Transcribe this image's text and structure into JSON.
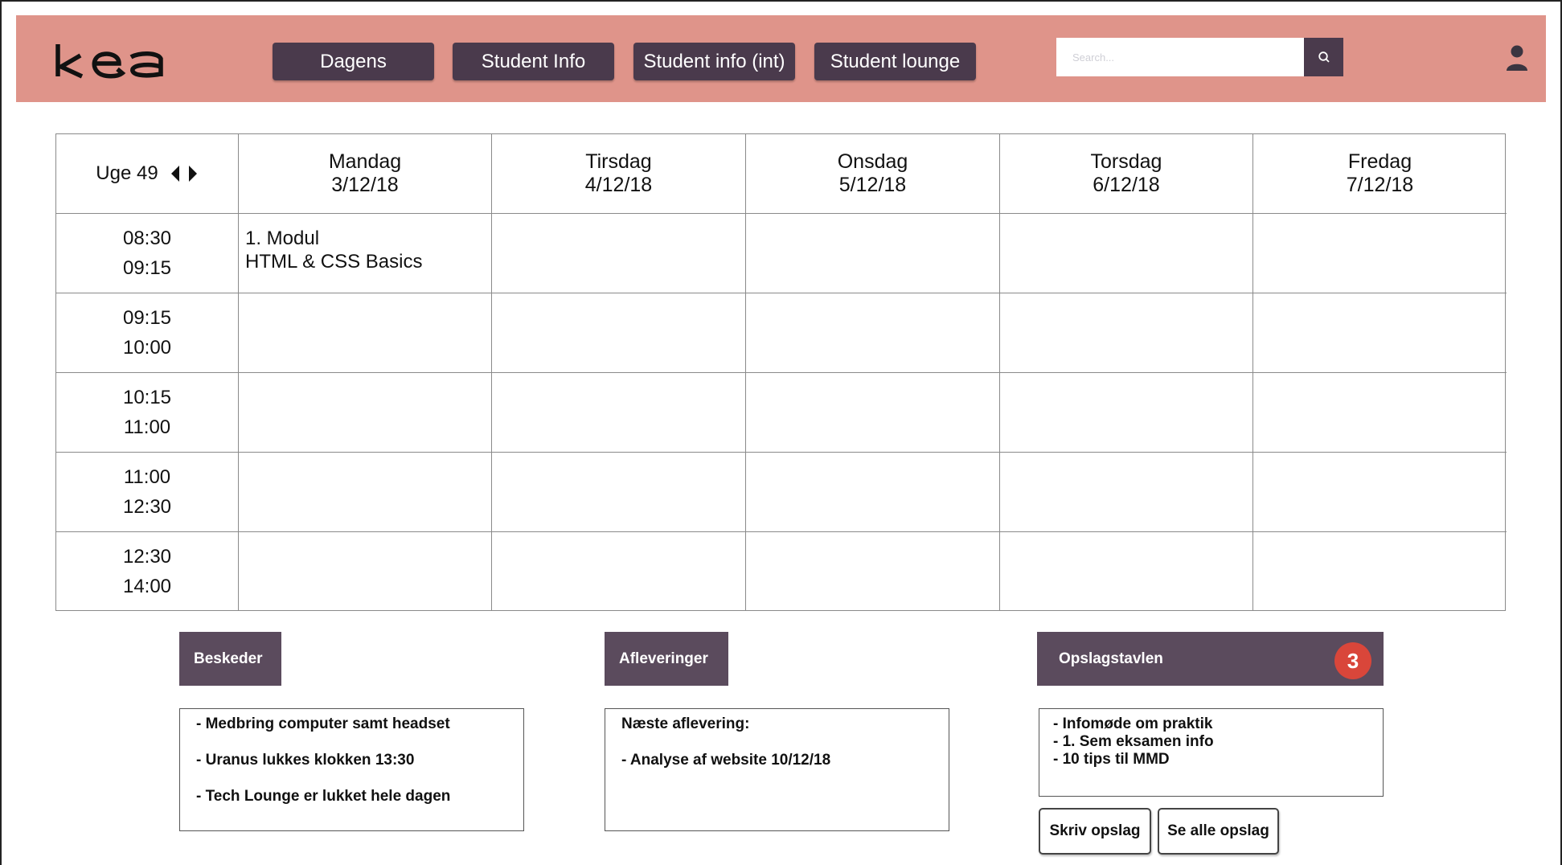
{
  "header": {
    "logo_text": "kea",
    "nav": [
      "Dagens",
      "Student Info",
      "Student info (int)",
      "Student lounge"
    ],
    "search_placeholder": "Search..."
  },
  "schedule": {
    "week_label": "Uge 49",
    "days": [
      {
        "name": "Mandag",
        "date": "3/12/18"
      },
      {
        "name": "Tirsdag",
        "date": "4/12/18"
      },
      {
        "name": "Onsdag",
        "date": "5/12/18"
      },
      {
        "name": "Torsdag",
        "date": "6/12/18"
      },
      {
        "name": "Fredag",
        "date": "7/12/18"
      }
    ],
    "times": [
      {
        "start": "08:30",
        "end": "09:15"
      },
      {
        "start": "09:15",
        "end": "10:00"
      },
      {
        "start": "10:15",
        "end": "11:00"
      },
      {
        "start": "11:00",
        "end": "12:30"
      },
      {
        "start": "12:30",
        "end": "14:00"
      }
    ],
    "event": {
      "line1": "1. Modul",
      "line2": "HTML & CSS Basics"
    }
  },
  "panels": {
    "beskeder": {
      "title": "Beskeder",
      "lines": [
        "- Medbring computer samt headset",
        "- Uranus lukkes klokken 13:30",
        "- Tech Lounge er lukket hele dagen"
      ]
    },
    "afleveringer": {
      "title": "Afleveringer",
      "lines": [
        "Næste aflevering:",
        "- Analyse af website 10/12/18"
      ]
    },
    "opslagstavlen": {
      "title": "Opslagstavlen",
      "badge": "3",
      "lines": [
        "- Infomøde om praktik",
        "- 1. Sem eksamen info",
        "- 10 tips til MMD"
      ],
      "write_label": "Skriv opslag",
      "see_all_label": "Se alle opslag"
    }
  },
  "colors": {
    "header_bg": "#df948a",
    "button_bg": "#4a3a4c",
    "panel_tab_bg": "#5b4b5d",
    "badge_bg": "#d9463a"
  }
}
